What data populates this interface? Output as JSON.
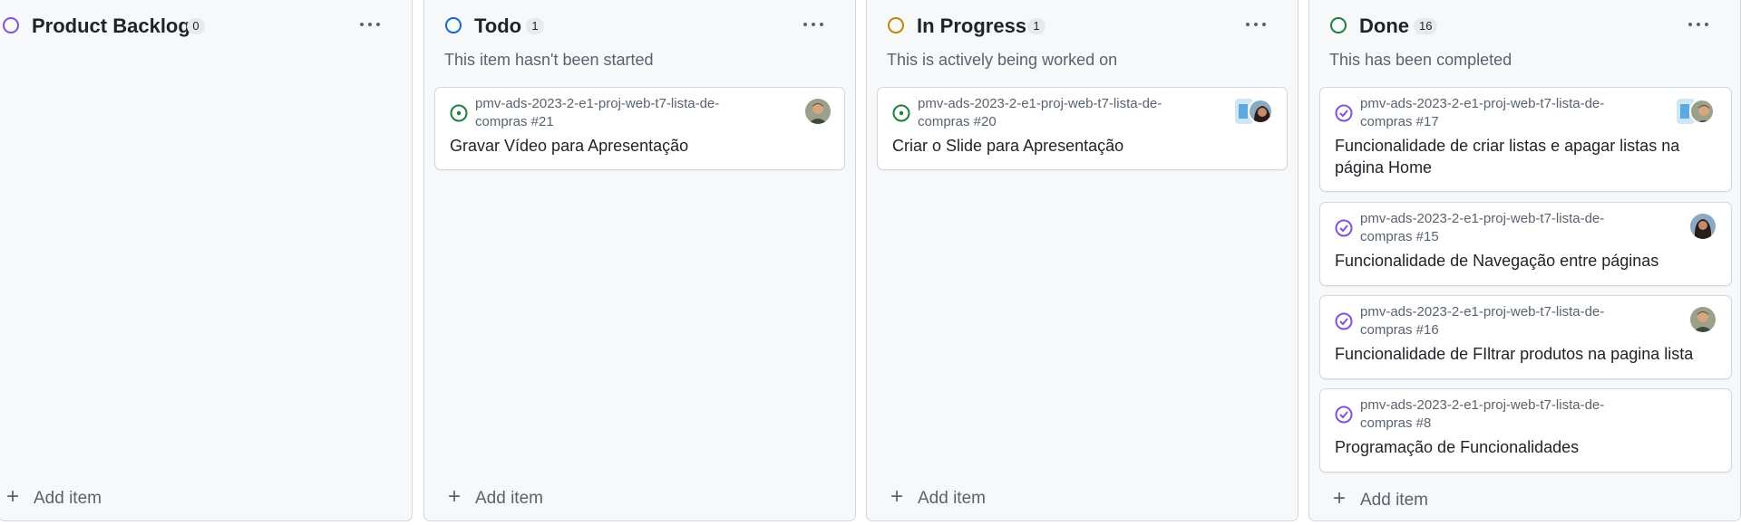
{
  "columns": [
    {
      "title": "Product Backlog",
      "count": "0",
      "description": "",
      "status_color": "#8250df",
      "more_icon": "kebab-horizontal-icon",
      "add_item": "Add item",
      "cards": []
    },
    {
      "title": "Todo",
      "count": "1",
      "description": "This item hasn't been started",
      "status_color": "#0969da",
      "more_icon": "kebab-horizontal-icon",
      "add_item": "Add item",
      "cards": [
        {
          "repo": "pmv-ads-2023-2-e1-proj-web-t7-lista-de-compras #21",
          "title": "Gravar Vídeo para Apresentação",
          "state": "open",
          "icon": "issue-opened-icon",
          "icon_color": "#1a7f37"
        }
      ]
    },
    {
      "title": "In Progress",
      "count": "1",
      "description": "This is actively being worked on",
      "status_color": "#bf8700",
      "more_icon": "kebab-horizontal-icon",
      "add_item": "Add item",
      "cards": [
        {
          "repo": "pmv-ads-2023-2-e1-proj-web-t7-lista-de-compras #20",
          "title": "Criar o Slide para Apresentação",
          "state": "open",
          "icon": "issue-opened-icon",
          "icon_color": "#1a7f37"
        }
      ]
    },
    {
      "title": "Done",
      "count": "16",
      "description": "This has been completed",
      "status_color": "#1a7f37",
      "more_icon": "kebab-horizontal-icon",
      "add_item": "Add item",
      "cards": [
        {
          "repo": "pmv-ads-2023-2-e1-proj-web-t7-lista-de-compras #17",
          "title": "Funcionalidade de criar listas e apagar listas na página Home",
          "state": "closed",
          "icon": "issue-closed-icon",
          "icon_color": "#8250df"
        },
        {
          "repo": "pmv-ads-2023-2-e1-proj-web-t7-lista-de-compras #15",
          "title": "Funcionalidade de Navegação entre páginas",
          "state": "closed",
          "icon": "issue-closed-icon",
          "icon_color": "#8250df"
        },
        {
          "repo": "pmv-ads-2023-2-e1-proj-web-t7-lista-de-compras #16",
          "title": "Funcionalidade de FIltrar produtos na pagina lista",
          "state": "closed",
          "icon": "issue-closed-icon",
          "icon_color": "#8250df"
        },
        {
          "repo": "pmv-ads-2023-2-e1-proj-web-t7-lista-de-compras #8",
          "title": "Programação de Funcionalidades",
          "state": "closed",
          "icon": "issue-closed-icon",
          "icon_color": "#8250df"
        }
      ]
    }
  ]
}
